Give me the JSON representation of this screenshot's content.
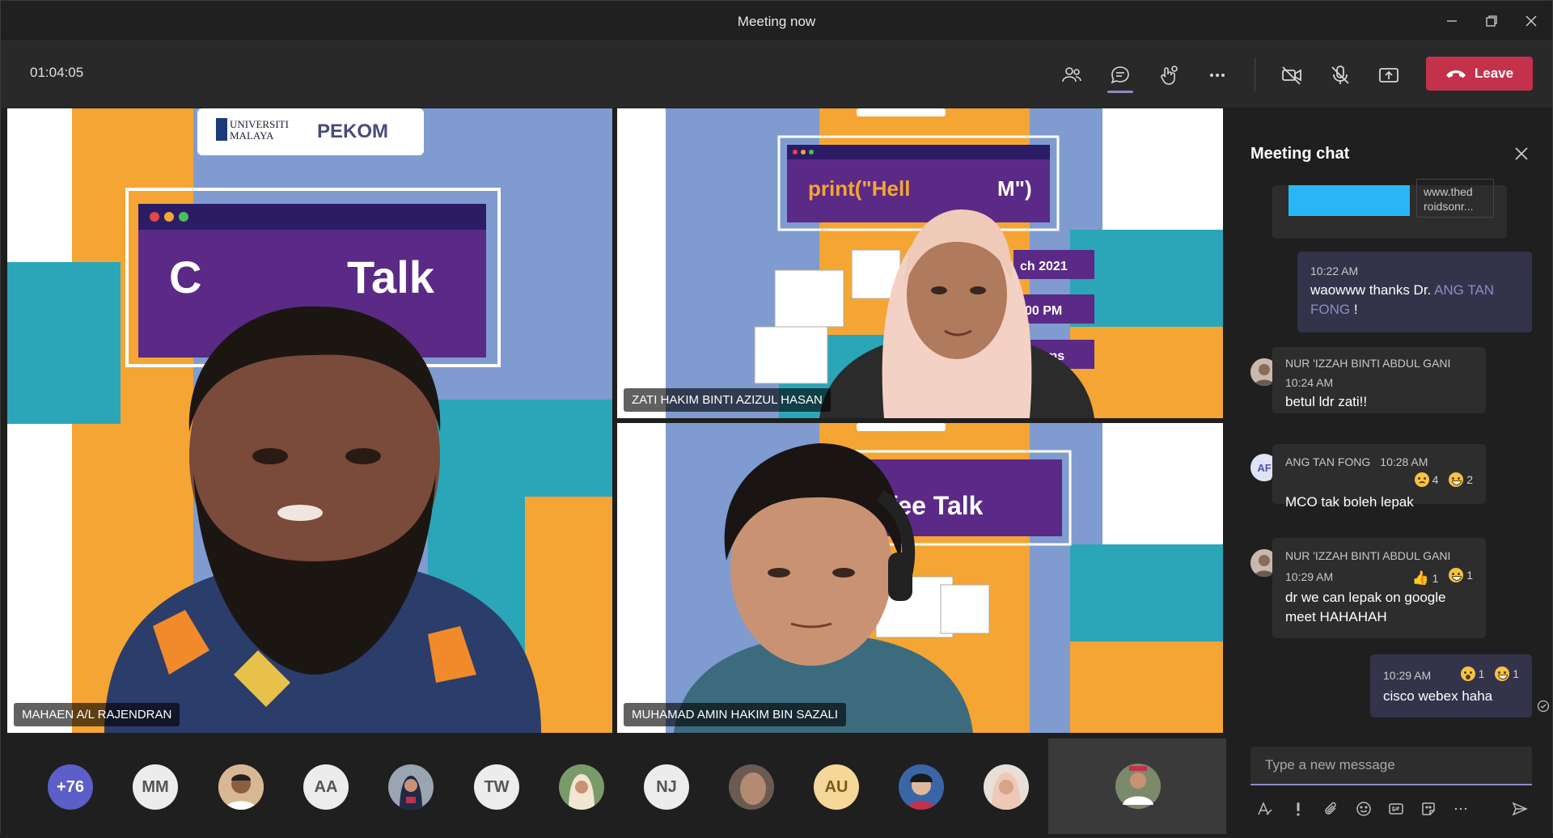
{
  "window": {
    "title": "Meeting now"
  },
  "toolbar": {
    "timer": "01:04:05",
    "leave_label": "Leave"
  },
  "videos": [
    {
      "name": "MAHAEN A/L RAJENDRAN",
      "slide_title": "Talk",
      "slide_brand": "PEKOM"
    },
    {
      "name": "ZATI HAKIM BINTI AZIZUL HASAN",
      "slide_code": "print(\"Hell",
      "slide_code_end": "M\")",
      "slide_date": "ch 2021",
      "slide_time": "- 4:00 PM",
      "slide_ms": "ms"
    },
    {
      "name": "MUHAMAD AMIN HAKIM BIN SAZALI",
      "slide_title": "ffee Talk"
    }
  ],
  "participants": {
    "overflow": "+76",
    "initials": [
      "MM",
      "AA",
      "TW",
      "NJ",
      "AU"
    ]
  },
  "chat": {
    "title": "Meeting chat",
    "link_preview": {
      "text1": "www.thed",
      "text2": "roidsonr..."
    },
    "messages": [
      {
        "time": "10:22 AM",
        "text_before": "waowww thanks Dr. ",
        "mention": "ANG TAN FONG",
        "text_after": " !"
      },
      {
        "sender": "NUR 'IZZAH BINTI ABDUL GANI",
        "time": "10:24 AM",
        "text": "betul ldr zati!!"
      },
      {
        "avatar": "AF",
        "sender": "ANG TAN FONG",
        "time": "10:28 AM",
        "text": "MCO tak boleh lepak",
        "reactions": [
          {
            "type": "sad",
            "count": "4"
          },
          {
            "type": "laugh",
            "count": "2"
          }
        ]
      },
      {
        "sender": "NUR 'IZZAH BINTI ABDUL GANI",
        "time": "10:29 AM",
        "text": "dr we can lepak on google meet HAHAHAH",
        "reactions": [
          {
            "type": "like",
            "count": "1"
          },
          {
            "type": "laugh",
            "count": "1"
          }
        ]
      },
      {
        "time": "10:29 AM",
        "text": "cisco webex haha",
        "reactions": [
          {
            "type": "wow",
            "count": "1"
          },
          {
            "type": "laugh",
            "count": "1"
          }
        ]
      }
    ],
    "compose_placeholder": "Type a new message"
  },
  "colors": {
    "accent": "#8b8cc7",
    "leave": "#c4314b",
    "slide_orange": "#f5a533",
    "slide_blue": "#7f9bd0",
    "slide_teal": "#2aa6b8",
    "slide_purple": "#5a2a86"
  }
}
